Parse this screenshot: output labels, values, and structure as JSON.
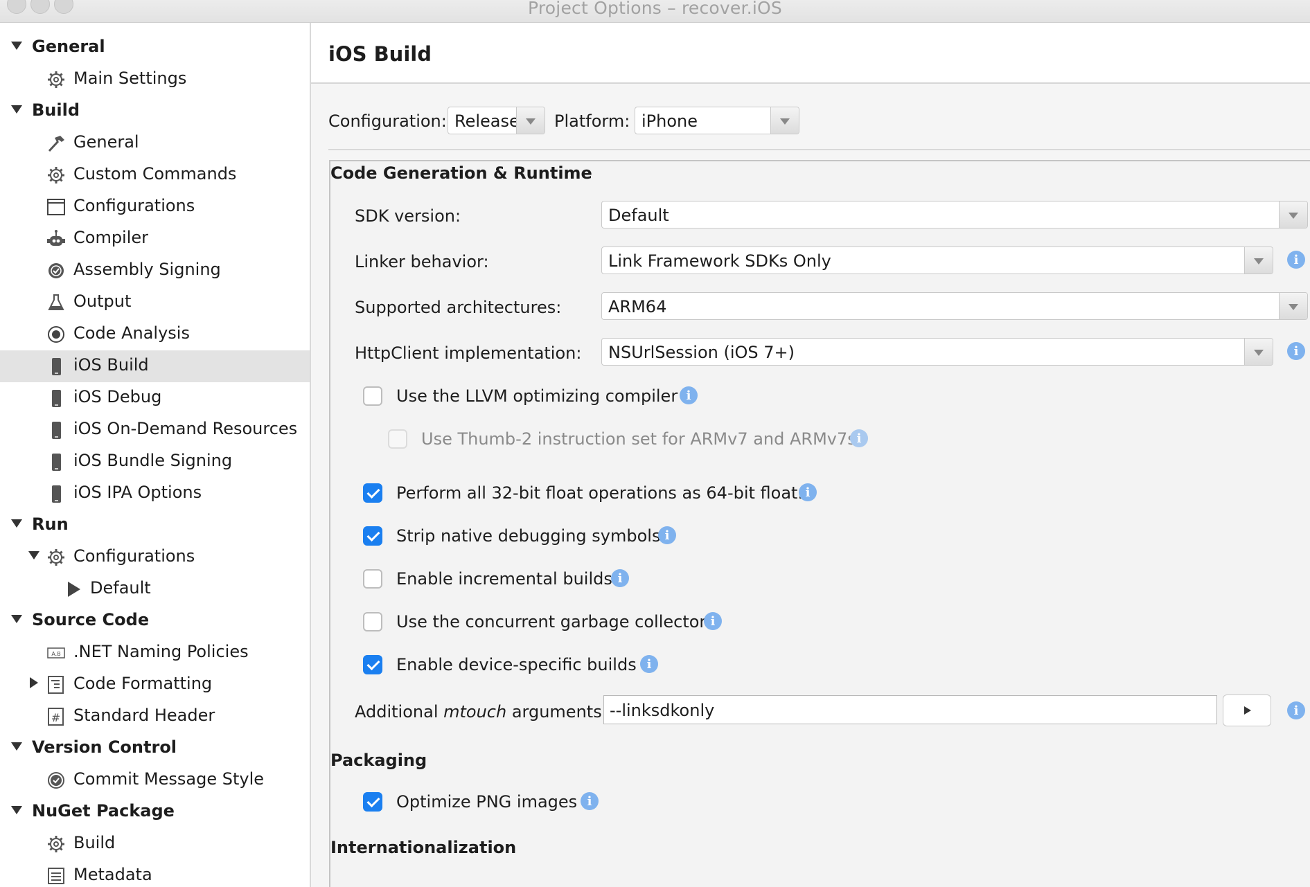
{
  "window": {
    "title": "Project Options – recover.iOS"
  },
  "sidebar": {
    "groups": [
      {
        "label": "General",
        "items": [
          {
            "label": "Main Settings",
            "icon": "gear-icon"
          }
        ]
      },
      {
        "label": "Build",
        "items": [
          {
            "label": "General",
            "icon": "hammer-icon"
          },
          {
            "label": "Custom Commands",
            "icon": "gear-icon"
          },
          {
            "label": "Configurations",
            "icon": "window-icon"
          },
          {
            "label": "Compiler",
            "icon": "robot-icon"
          },
          {
            "label": "Assembly Signing",
            "icon": "seal-icon"
          },
          {
            "label": "Output",
            "icon": "flask-icon"
          },
          {
            "label": "Code Analysis",
            "icon": "target-icon"
          },
          {
            "label": "iOS Build",
            "icon": "phone-icon",
            "selected": true
          },
          {
            "label": "iOS Debug",
            "icon": "phone-icon"
          },
          {
            "label": "iOS On-Demand Resources",
            "icon": "phone-icon"
          },
          {
            "label": "iOS Bundle Signing",
            "icon": "phone-icon"
          },
          {
            "label": "iOS IPA Options",
            "icon": "phone-icon"
          }
        ]
      },
      {
        "label": "Run",
        "items": [
          {
            "label": "Configurations",
            "icon": "gear-icon"
          },
          {
            "label": "Default",
            "icon": "play-icon"
          }
        ]
      },
      {
        "label": "Source Code",
        "items": [
          {
            "label": ".NET Naming Policies",
            "icon": "naming-icon"
          },
          {
            "label": "Code Formatting",
            "icon": "format-icon"
          },
          {
            "label": "Standard Header",
            "icon": "hash-icon"
          }
        ]
      },
      {
        "label": "Version Control",
        "items": [
          {
            "label": "Commit Message Style",
            "icon": "check-circle-icon"
          }
        ]
      },
      {
        "label": "NuGet Package",
        "items": [
          {
            "label": "Build",
            "icon": "gear-icon"
          },
          {
            "label": "Metadata",
            "icon": "list-icon"
          }
        ]
      }
    ]
  },
  "main": {
    "title": "iOS Build",
    "configuration": {
      "label": "Configuration:",
      "value": "Release"
    },
    "platform": {
      "label": "Platform:",
      "value": "iPhone"
    },
    "code_gen": {
      "title": "Code Generation & Runtime",
      "sdk": {
        "label": "SDK version:",
        "value": "Default"
      },
      "linker": {
        "label": "Linker behavior:",
        "value": "Link Framework SDKs Only"
      },
      "arch": {
        "label": "Supported architectures:",
        "value": "ARM64"
      },
      "http": {
        "label": "HttpClient implementation:",
        "value": "NSUrlSession (iOS 7+)"
      },
      "options": [
        {
          "label": "Use the LLVM optimizing compiler",
          "checked": false
        },
        {
          "label": "Use Thumb-2 instruction set for ARMv7 and ARMv7s",
          "checked": false,
          "disabled": true
        },
        {
          "label": "Perform all 32-bit float operations as 64-bit float.",
          "checked": true
        },
        {
          "label": "Strip native debugging symbols",
          "checked": true
        },
        {
          "label": "Enable incremental builds",
          "checked": false
        },
        {
          "label": "Use the concurrent garbage collector",
          "checked": false
        },
        {
          "label": "Enable device-specific builds",
          "checked": true
        }
      ],
      "mtouch": {
        "label_prefix": "Additional ",
        "label_em": "mtouch",
        "label_suffix": " arguments:",
        "value": "--linksdkonly"
      }
    },
    "packaging": {
      "title": "Packaging",
      "options": [
        {
          "label": "Optimize PNG images",
          "checked": true
        }
      ]
    },
    "internationalization": {
      "title": "Internationalization"
    },
    "info_glyph": "i",
    "colors": {
      "accent": "#1a7ff0",
      "info": "#7fb2ee",
      "selected_row": "#e3e3e3"
    }
  }
}
